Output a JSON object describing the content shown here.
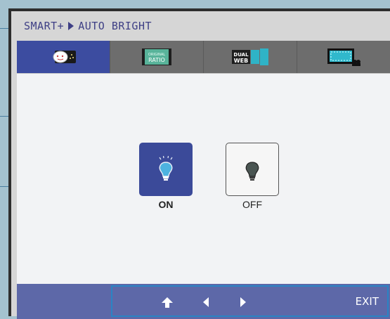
{
  "breadcrumb": {
    "parent": "SMART+",
    "current": "AUTO BRIGHT"
  },
  "tabs": [
    {
      "name": "auto-bright",
      "icon": "face-screen-icon",
      "active": true
    },
    {
      "name": "original-ratio",
      "icon": "original-ratio-icon",
      "text": "ORIGINAL RATIO",
      "line1": "ORIGINAL",
      "line2": "RATIO",
      "active": false
    },
    {
      "name": "dual-web",
      "icon": "dual-web-icon",
      "line1": "DUAL",
      "line2": "WEB",
      "active": false
    },
    {
      "name": "screen-video",
      "icon": "video-screen-icon",
      "active": false
    }
  ],
  "options": {
    "on_label": "ON",
    "off_label": "OFF",
    "selected": "ON"
  },
  "footer": {
    "exit_label": "EXIT",
    "nav": [
      "up-arrow-icon",
      "left-arrow-icon",
      "right-arrow-icon"
    ]
  },
  "colors": {
    "active_tab": "#3c4ca0",
    "inactive_tab": "#6d6d6d",
    "footer": "#5d68a8",
    "nav_border": "#2a84c4",
    "title_text": "#3e3f85"
  }
}
